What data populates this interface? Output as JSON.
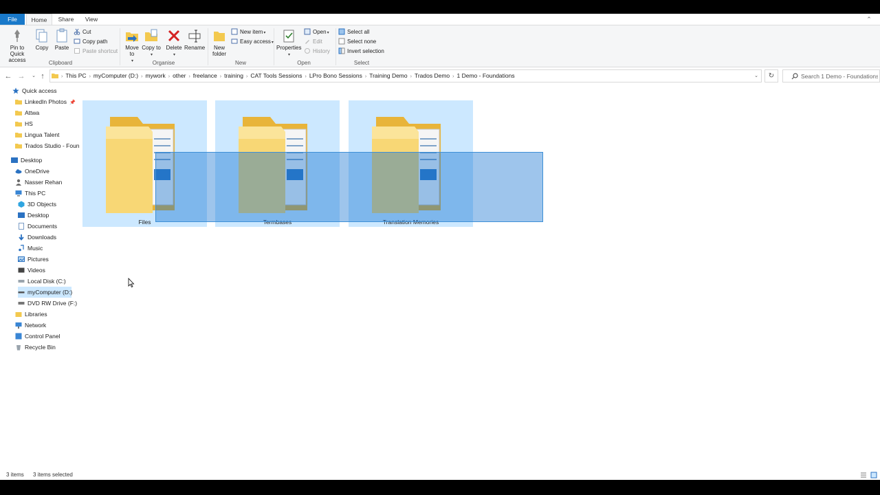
{
  "tabs": {
    "file": "File",
    "home": "Home",
    "share": "Share",
    "view": "View"
  },
  "ribbon": {
    "clipboard": {
      "pin_label": "Pin to Quick access",
      "copy_label": "Copy",
      "paste_label": "Paste",
      "cut_label": "Cut",
      "copy_path_label": "Copy path",
      "paste_shortcut_label": "Paste shortcut",
      "group_label": "Clipboard"
    },
    "organise": {
      "move_label": "Move to",
      "copy_to_label": "Copy to",
      "delete_label": "Delete",
      "rename_label": "Rename",
      "group_label": "Organise"
    },
    "new": {
      "new_folder_label": "New folder",
      "new_item_label": "New item",
      "easy_access_label": "Easy access",
      "group_label": "New"
    },
    "open": {
      "properties_label": "Properties",
      "open_label": "Open",
      "edit_label": "Edit",
      "history_label": "History",
      "group_label": "Open"
    },
    "select": {
      "select_all_label": "Select all",
      "select_none_label": "Select none",
      "invert_label": "Invert selection",
      "group_label": "Select"
    }
  },
  "address": {
    "crumbs": [
      "This PC",
      "myComputer (D:)",
      "mywork",
      "other",
      "freelance",
      "training",
      "CAT Tools Sessions",
      "LPro Bono Sessions",
      "Training Demo",
      "Trados Demo",
      "1 Demo - Foundations"
    ],
    "search_placeholder": "Search 1 Demo - Foundations"
  },
  "nav": {
    "quick_access": "Quick access",
    "quick_items": [
      "LinkedIn Photos",
      "Attwa",
      "HS",
      "Lingua Talent",
      "Trados Studio - Foun"
    ],
    "desktop": "Desktop",
    "onedrive": "OneDrive",
    "user": "Nasser Rehan",
    "this_pc": "This PC",
    "pc_items": [
      "3D Objects",
      "Desktop",
      "Documents",
      "Downloads",
      "Music",
      "Pictures",
      "Videos",
      "Local Disk (C:)",
      "myComputer (D:)",
      "DVD RW Drive (F:)"
    ],
    "libraries": "Libraries",
    "network": "Network",
    "control_panel": "Control Panel",
    "recycle_bin": "Recycle Bin"
  },
  "content": {
    "folders": [
      "Files",
      "Termbases",
      "Translation Memories"
    ]
  },
  "status": {
    "count": "3 items",
    "selected": "3 items selected"
  },
  "colors": {
    "accent": "#1979ca",
    "selection": "#cce8ff",
    "marquee": "#3d8fd6"
  }
}
